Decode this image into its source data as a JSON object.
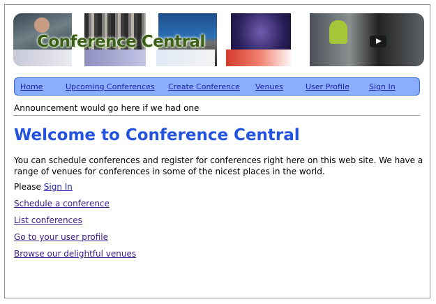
{
  "banner": {
    "title": "Conference Central"
  },
  "nav": {
    "items": [
      {
        "label": "Home"
      },
      {
        "label": "Upcoming Conferences"
      },
      {
        "label": "Create Conference"
      },
      {
        "label": "Venues"
      },
      {
        "label": "User Profile"
      },
      {
        "label": "Sign In"
      }
    ]
  },
  "announcement": "Announcement would go here if we had one",
  "main": {
    "heading": "Welcome to Conference Central",
    "intro": "You can schedule conferences and register for conferences right here on this web site. We have a range of venues for conferences in some of the nicest places in the world.",
    "please_text": "Please",
    "sign_in_link": "Sign In",
    "links": [
      {
        "label": "Schedule a conference"
      },
      {
        "label": "List conferences"
      },
      {
        "label": "Go to your user profile"
      },
      {
        "label": "Browse our delightful venues"
      }
    ]
  },
  "colors": {
    "heading": "#2453e0",
    "nav_background": "#8aaefc",
    "nav_border": "#2f66d8",
    "link": "#1f1fa8",
    "banner_title": "#3b5f16"
  },
  "icons": {
    "video_play": "play-icon"
  }
}
